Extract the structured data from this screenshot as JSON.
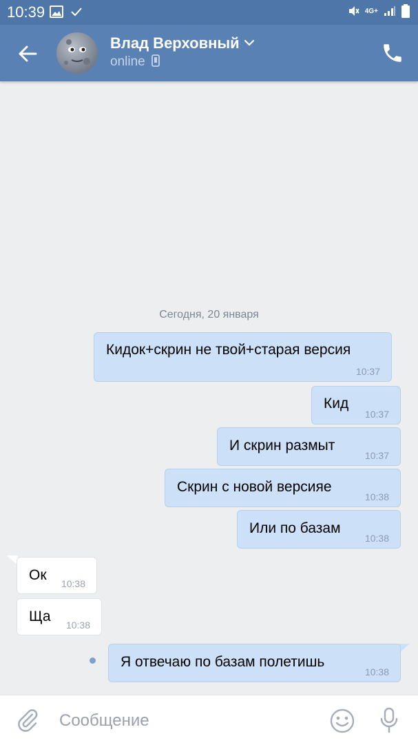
{
  "status_bar": {
    "time": "10:39",
    "network": "4G+"
  },
  "header": {
    "contact_name": "Влад Верховный",
    "status": "online"
  },
  "chat": {
    "date_separator": "Сегодня, 20 января",
    "messages": [
      {
        "direction": "out",
        "text": "Кидок+скрин не твой+старая версия",
        "time": "10:37"
      },
      {
        "direction": "out",
        "text": "Кид",
        "time": "10:37"
      },
      {
        "direction": "out",
        "text": "И скрин размыт",
        "time": "10:37"
      },
      {
        "direction": "out",
        "text": "Скрин с новой версияе",
        "time": "10:38"
      },
      {
        "direction": "out",
        "text": "Или по базам",
        "time": "10:38"
      },
      {
        "direction": "in",
        "text": "Ок",
        "time": "10:38"
      },
      {
        "direction": "in",
        "text": "Ща",
        "time": "10:38"
      },
      {
        "direction": "out",
        "text": "Я отвечаю по базам полетишь",
        "time": "10:38"
      }
    ]
  },
  "composer": {
    "placeholder": "Сообщение"
  },
  "colors": {
    "header": "#5a81b3",
    "status_bar": "#4f76a8",
    "outgoing_bubble": "#cce0f8",
    "incoming_bubble": "#ffffff",
    "background": "#edeef0"
  },
  "icons": [
    "image-icon",
    "check-icon",
    "mute-icon",
    "signal-icon",
    "battery-icon",
    "back-arrow-icon",
    "chevron-down-icon",
    "mobile-icon",
    "phone-icon",
    "paperclip-icon",
    "emoji-icon",
    "microphone-icon"
  ]
}
